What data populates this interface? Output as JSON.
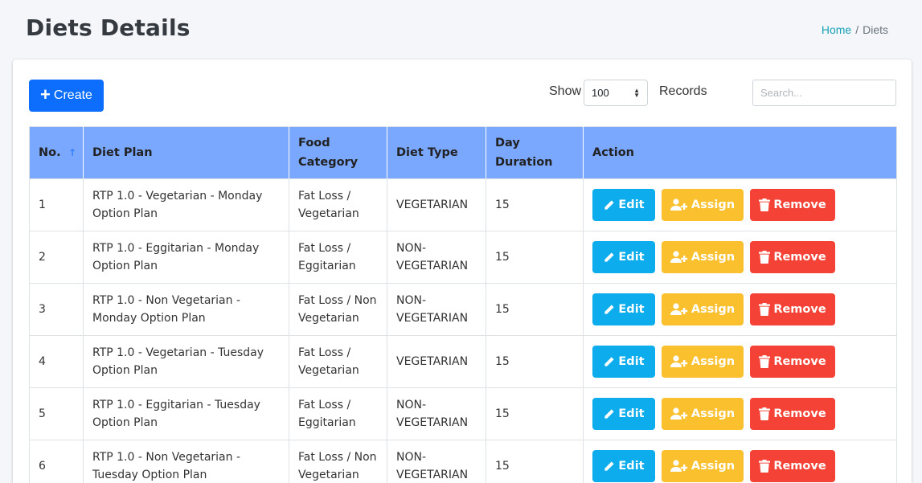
{
  "page": {
    "title": "Diets Details",
    "breadcrumb": {
      "home": "Home",
      "separator": "/",
      "current": "Diets"
    }
  },
  "toolbar": {
    "create_label": "Create",
    "show_label": "Show",
    "records_value": "100",
    "records_label": "Records",
    "search_placeholder": "Search..."
  },
  "table": {
    "columns": [
      "No.",
      "Diet Plan",
      "Food Category",
      "Diet Type",
      "Day Duration",
      "Action"
    ],
    "rows": [
      {
        "no": "1",
        "plan": "RTP 1.0 - Vegetarian - Monday Option Plan",
        "category": "Fat Loss / Vegetarian",
        "type": "VEGETARIAN",
        "duration": "15"
      },
      {
        "no": "2",
        "plan": "RTP 1.0 - Eggitarian - Monday Option Plan",
        "category": "Fat Loss / Eggitarian",
        "type": "NON-VEGETARIAN",
        "duration": "15"
      },
      {
        "no": "3",
        "plan": "RTP 1.0 - Non Vegetarian - Monday Option Plan",
        "category": "Fat Loss / Non Vegetarian",
        "type": "NON-VEGETARIAN",
        "duration": "15"
      },
      {
        "no": "4",
        "plan": "RTP 1.0 - Vegetarian - Tuesday Option Plan",
        "category": "Fat Loss / Vegetarian",
        "type": "VEGETARIAN",
        "duration": "15"
      },
      {
        "no": "5",
        "plan": "RTP 1.0 - Eggitarian - Tuesday Option Plan",
        "category": "Fat Loss / Eggitarian",
        "type": "NON-VEGETARIAN",
        "duration": "15"
      },
      {
        "no": "6",
        "plan": "RTP 1.0 - Non Vegetarian - Tuesday Option Plan",
        "category": "Fat Loss / Non Vegetarian",
        "type": "NON-VEGETARIAN",
        "duration": "15"
      }
    ],
    "actions": {
      "edit": "Edit",
      "assign": "Assign",
      "remove": "Remove"
    }
  },
  "icons": {
    "create": "plus-icon",
    "sort": "sort-ascending-icon",
    "select": "chevron-updown-icon",
    "edit": "pencil-icon",
    "assign": "user-plus-icon",
    "remove": "trash-icon"
  },
  "colors": {
    "primary": "#0d6efd",
    "header": "#7aa7ff",
    "edit": "#0dacec",
    "assign": "#fbc02d",
    "remove": "#f44336",
    "link": "#17a2b8"
  }
}
